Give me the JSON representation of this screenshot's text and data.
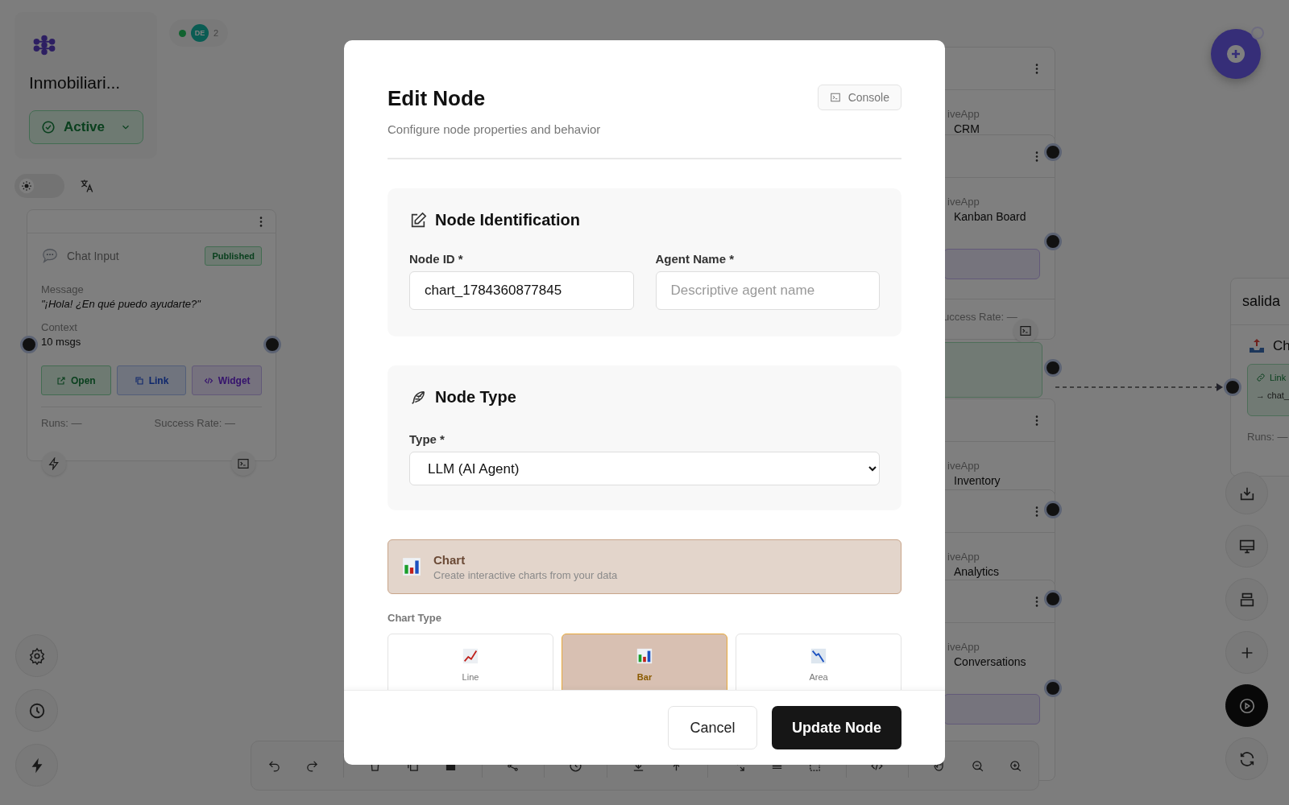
{
  "workspace": {
    "title": "Inmobiliari...",
    "status": "Active"
  },
  "theme_toggle": {
    "on": false
  },
  "presence": {
    "online": true,
    "initials": "DE",
    "count": "2"
  },
  "chat_node": {
    "title": "Chat Input",
    "badge": "Published",
    "fields": [
      {
        "label": "Message",
        "value": "\"¡Hola! ¿En qué puedo ayudarte?\"",
        "kind": "quote"
      },
      {
        "label": "Context",
        "value": "10 msgs",
        "kind": "plain"
      }
    ],
    "actions": [
      {
        "label": "Open",
        "kind": "open"
      },
      {
        "label": "Link",
        "kind": "link"
      },
      {
        "label": "Widget",
        "kind": "widget"
      }
    ],
    "stats": [
      "Runs: —",
      "Success Rate: —"
    ]
  },
  "app_nodes": [
    {
      "type": "iveApp",
      "name": "CRM"
    },
    {
      "type": "iveApp",
      "name": "Kanban Board",
      "stats": "uccess Rate: —"
    },
    {
      "type": "iveApp",
      "name": "Inventory"
    },
    {
      "type": "iveApp",
      "name": "Analytics"
    },
    {
      "type": "iveApp",
      "name": "Conversations"
    }
  ],
  "output_node": {
    "title": "salida",
    "name": "Ch",
    "link": "Link",
    "target": "→ chat_",
    "stats": "Runs: —"
  },
  "modal": {
    "title": "Edit Node",
    "subtitle": "Configure node properties and behavior",
    "console": "Console",
    "identification": {
      "title": "Node Identification",
      "fields": [
        {
          "label": "Node ID *",
          "value": "chart_1784360877845"
        },
        {
          "label": "Agent Name *",
          "placeholder": "Descriptive agent name"
        }
      ]
    },
    "node_type": {
      "title": "Node Type",
      "label": "Type *",
      "value": "LLM (AI Agent)"
    },
    "selected_type": {
      "title": "Chart",
      "description": "Create interactive charts from your data"
    },
    "chart_type": {
      "label": "Chart Type",
      "options": [
        {
          "label": "Line",
          "kind": "line",
          "selected": false
        },
        {
          "label": "Bar",
          "kind": "bar",
          "selected": true
        },
        {
          "label": "Area",
          "kind": "area",
          "selected": false
        }
      ]
    },
    "buttons": {
      "cancel": "Cancel",
      "submit": "Update Node"
    }
  }
}
